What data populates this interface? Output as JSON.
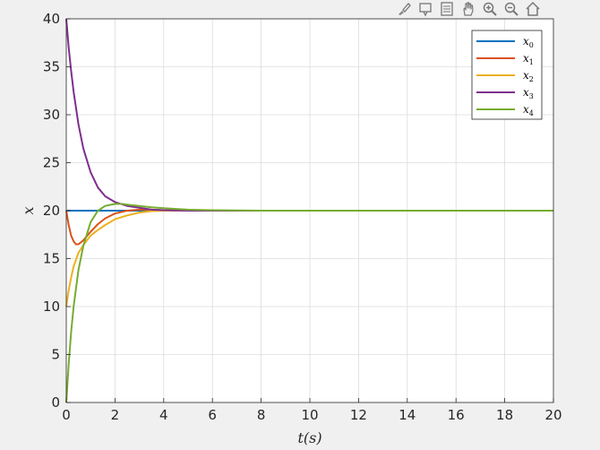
{
  "toolbar": {
    "icons": [
      "brush-icon",
      "data-tips-icon",
      "datatip-list-icon",
      "pan-hand-icon",
      "zoom-in-icon",
      "zoom-out-icon",
      "home-icon"
    ]
  },
  "colors": {
    "background": "#f0f0f0",
    "axes": "#ffffff",
    "grid": "#dcdcdc"
  },
  "chart_data": {
    "type": "line",
    "xlabel": "t(s)",
    "ylabel": "x",
    "xlim": [
      0,
      20
    ],
    "ylim": [
      0,
      40
    ],
    "xticks": [
      0,
      2,
      4,
      6,
      8,
      10,
      12,
      14,
      16,
      18,
      20
    ],
    "yticks": [
      0,
      5,
      10,
      15,
      20,
      25,
      30,
      35,
      40
    ],
    "grid": true,
    "legend_position": "top-right",
    "series": [
      {
        "name": "x_0",
        "base": "x",
        "sub": "0",
        "color": "#0072bd",
        "x": [
          0,
          20
        ],
        "y": [
          20,
          20
        ]
      },
      {
        "name": "x_1",
        "base": "x",
        "sub": "1",
        "color": "#d95319",
        "x": [
          0,
          0.1,
          0.2,
          0.3,
          0.4,
          0.5,
          0.7,
          1.0,
          1.3,
          1.6,
          2.0,
          2.5,
          3.0,
          3.5,
          4.0,
          5.0,
          6.0,
          8.0,
          10.0,
          14.0,
          20.0
        ],
        "y": [
          20,
          18.5,
          17.4,
          16.8,
          16.5,
          16.5,
          16.9,
          17.8,
          18.6,
          19.2,
          19.7,
          20.0,
          20.1,
          20.1,
          20.05,
          20.0,
          20.0,
          20.0,
          20.0,
          20.0,
          20.0
        ]
      },
      {
        "name": "x_2",
        "base": "x",
        "sub": "2",
        "color": "#edb120",
        "x": [
          0,
          0.1,
          0.2,
          0.3,
          0.5,
          0.7,
          1.0,
          1.3,
          1.6,
          2.0,
          2.5,
          3.0,
          3.5,
          4.0,
          5.0,
          6.0,
          8.0,
          10.0,
          14.0,
          20.0
        ],
        "y": [
          10,
          11.7,
          13.0,
          14.2,
          15.6,
          16.4,
          17.4,
          18.0,
          18.5,
          19.1,
          19.5,
          19.8,
          19.95,
          20.0,
          20.0,
          20.0,
          20.0,
          20.0,
          20.0,
          20.0
        ]
      },
      {
        "name": "x_3",
        "base": "x",
        "sub": "3",
        "color": "#7e2f8e",
        "x": [
          0,
          0.1,
          0.2,
          0.3,
          0.5,
          0.7,
          1.0,
          1.3,
          1.6,
          2.0,
          2.5,
          3.0,
          3.5,
          4.0,
          5.0,
          6.0,
          8.0,
          10.0,
          14.0,
          20.0
        ],
        "y": [
          40,
          37.0,
          34.6,
          32.4,
          29.0,
          26.5,
          24.0,
          22.4,
          21.5,
          20.9,
          20.5,
          20.3,
          20.1,
          20.05,
          20.0,
          20.0,
          20.0,
          20.0,
          20.0,
          20.0
        ]
      },
      {
        "name": "x_4",
        "base": "x",
        "sub": "4",
        "color": "#77ac30",
        "x": [
          0,
          0.1,
          0.2,
          0.3,
          0.5,
          0.7,
          1.0,
          1.3,
          1.6,
          2.0,
          2.3,
          2.6,
          3.0,
          3.5,
          4.0,
          5.0,
          6.0,
          8.0,
          10.0,
          14.0,
          20.0
        ],
        "y": [
          0,
          4.0,
          7.3,
          10.0,
          13.8,
          16.3,
          18.8,
          20.0,
          20.5,
          20.7,
          20.7,
          20.6,
          20.5,
          20.35,
          20.25,
          20.1,
          20.05,
          20.0,
          20.0,
          20.0,
          20.0
        ]
      }
    ]
  }
}
